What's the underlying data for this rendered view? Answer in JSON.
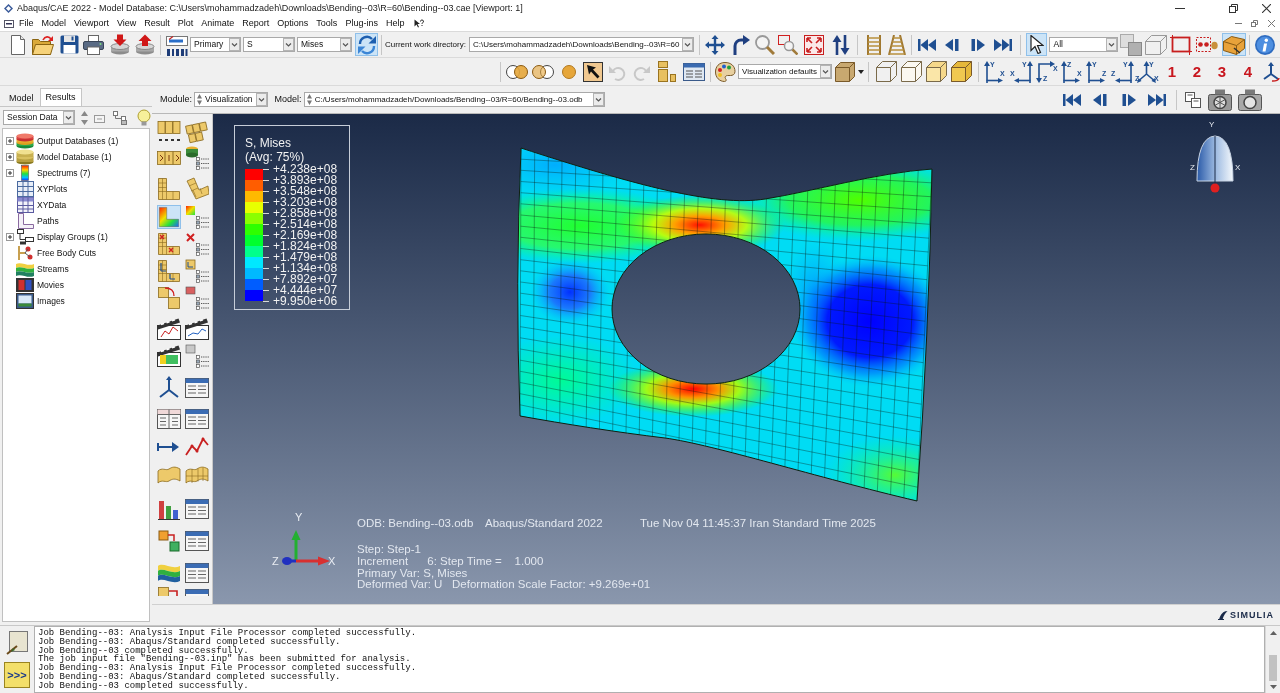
{
  "window": {
    "title": "Abaqus/CAE 2022 - Model Database: C:\\Users\\mohammadzadeh\\Downloads\\Bending--03\\R=60\\Bending--03.cae [Viewport: 1]"
  },
  "menu_bar": [
    "File",
    "Model",
    "Viewport",
    "View",
    "Result",
    "Plot",
    "Animate",
    "Report",
    "Options",
    "Tools",
    "Plug-ins",
    "Help"
  ],
  "toolbar": {
    "output_position": "Primary",
    "variable": "S",
    "invariant": "Mises",
    "work_directory_label": "Current work directory:",
    "work_directory": "C:\\Users\\mohammadzadeh\\Downloads\\Bending--03\\R=60",
    "selection_filter": "All",
    "render_style": "Visualization defaults",
    "view_buttons": [
      {
        "kind": "up-right",
        "labels": [
          "Y",
          "X"
        ]
      },
      {
        "kind": "up-left",
        "labels": [
          "Y",
          "X"
        ]
      },
      {
        "kind": "right-down",
        "labels": [
          "X",
          "Z"
        ]
      },
      {
        "kind": "up-right",
        "labels": [
          "Z",
          "X"
        ]
      },
      {
        "kind": "up-right",
        "labels": [
          "Y",
          "Z"
        ]
      },
      {
        "kind": "up-left",
        "labels": [
          "Y",
          "Z"
        ]
      },
      {
        "kind": "iso",
        "labels": [
          "Y",
          "Z",
          "X"
        ]
      }
    ],
    "view_numbers": [
      "1",
      "2",
      "3",
      "4"
    ]
  },
  "tool_states": {
    "sync_output": true,
    "select_mode": true,
    "query_tool": true,
    "contour_plot": true
  },
  "tabs": [
    {
      "label": "Model",
      "selected": false
    },
    {
      "label": "Results",
      "selected": true
    }
  ],
  "context_bar": {
    "module_label": "Module:",
    "module": "Visualization",
    "model_label": "Model:",
    "model": "C:/Users/mohammadzadeh/Downloads/Bending--03/R=60/Bending--03.odb"
  },
  "session_tree": {
    "source": "Session Data",
    "items": [
      {
        "label": "Output Databases (1)",
        "kind": "group",
        "expanded": false
      },
      {
        "label": "Model Database (1)",
        "kind": "group",
        "expanded": false
      },
      {
        "label": "Spectrums (7)",
        "kind": "group",
        "expanded": false
      },
      {
        "label": "XYPlots",
        "kind": "leaf"
      },
      {
        "label": "XYData",
        "kind": "leaf"
      },
      {
        "label": "Paths",
        "kind": "leaf"
      },
      {
        "label": "Display Groups (1)",
        "kind": "group",
        "expanded": false
      },
      {
        "label": "Free Body Cuts",
        "kind": "leaf"
      },
      {
        "label": "Streams",
        "kind": "leaf"
      },
      {
        "label": "Movies",
        "kind": "leaf"
      },
      {
        "label": "Images",
        "kind": "leaf"
      }
    ]
  },
  "viewport": {
    "legend": {
      "title": "S, Mises",
      "subtitle": "(Avg: 75%)",
      "bands": [
        {
          "color": "#ff0000"
        },
        {
          "color": "#ff5d00"
        },
        {
          "color": "#ffb900"
        },
        {
          "color": "#e8ff00"
        },
        {
          "color": "#8bff00"
        },
        {
          "color": "#2eff00"
        },
        {
          "color": "#00ff2e"
        },
        {
          "color": "#00ff8b"
        },
        {
          "color": "#00e8ff"
        },
        {
          "color": "#00b9ff"
        },
        {
          "color": "#005dff"
        },
        {
          "color": "#0000ff"
        }
      ],
      "labels": [
        "+4.238e+08",
        "+3.893e+08",
        "+3.548e+08",
        "+3.203e+08",
        "+2.858e+08",
        "+2.514e+08",
        "+2.169e+08",
        "+1.824e+08",
        "+1.479e+08",
        "+1.134e+08",
        "+7.892e+07",
        "+4.444e+07",
        "+9.950e+06"
      ]
    },
    "info": {
      "odb": "ODB: Bending--03.odb",
      "solver": "Abaqus/Standard 2022",
      "date": "Tue Nov 04 11:45:37 Iran Standard Time 2025",
      "lines": [
        "Step: Step-1",
        "Increment      6: Step Time =    1.000",
        "Primary Var: S, Mises",
        "Deformed Var: U   Deformation Scale Factor: +9.269e+01"
      ]
    },
    "triad": {
      "labels": [
        "Y",
        "Z",
        "X"
      ]
    },
    "view_dome": {
      "labels": [
        "Y",
        "Z",
        "X"
      ]
    }
  },
  "brand": "SIMULIA",
  "message_area": {
    "prompt": ">>>",
    "lines": [
      "Job Bending--03: Analysis Input File Processor completed successfully.",
      "Job Bending--03: Abaqus/Standard completed successfully.",
      "Job Bending--03 completed successfully.",
      "The job input file \"Bending--03.inp\" has been submitted for analysis.",
      "Job Bending--03: Analysis Input File Processor completed successfully.",
      "Job Bending--03: Abaqus/Standard completed successfully.",
      "Job Bending--03 completed successfully."
    ]
  }
}
